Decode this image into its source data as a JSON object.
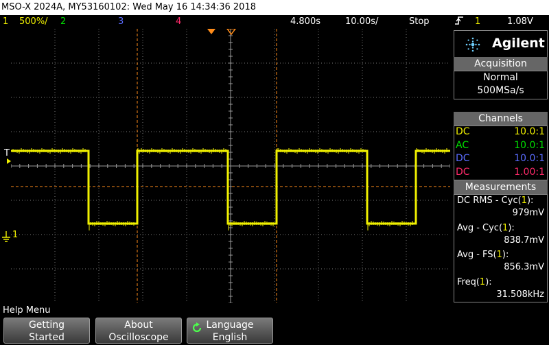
{
  "title": "MSO-X 2024A, MY53160102: Wed May 16 14:34:36 2018",
  "status": {
    "ch1_num": "1",
    "ch1_scale": "500%/",
    "ch2_num": "2",
    "ch3_num": "3",
    "ch4_num": "4",
    "delay": "4.800s",
    "timebase": "10.00s/",
    "run_state": "Stop",
    "trigger_icon": "trigger-edge-icon",
    "trigger_source": "1",
    "trigger_level": "1.08V"
  },
  "screen": {
    "ground_marker": "1",
    "trigger_marker": "T"
  },
  "panel": {
    "brand": "Agilent",
    "acquisition": {
      "header": "Acquisition",
      "mode": "Normal",
      "rate": "500MSa/s"
    },
    "channels": {
      "header": "Channels",
      "rows": [
        {
          "coupling": "DC",
          "probe": "10.0:1",
          "color": "#f0f000"
        },
        {
          "coupling": "AC",
          "probe": "10.0:1",
          "color": "#00e000"
        },
        {
          "coupling": "DC",
          "probe": "10.0:1",
          "color": "#5a6cff"
        },
        {
          "coupling": "DC",
          "probe": "1.00:1",
          "color": "#ff2a6a"
        }
      ]
    },
    "measurements": {
      "header": "Measurements",
      "items": [
        {
          "prefix": "DC RMS - Cyc(",
          "ch": "1",
          "suffix": "):",
          "value": "979mV"
        },
        {
          "prefix": "Avg - Cyc(",
          "ch": "1",
          "suffix": "):",
          "value": "838.7mV"
        },
        {
          "prefix": "Avg - FS(",
          "ch": "1",
          "suffix": "):",
          "value": "856.3mV"
        },
        {
          "prefix": "Freq(",
          "ch": "1",
          "suffix": "):",
          "value": "31.508kHz"
        }
      ]
    }
  },
  "help": "Help Menu",
  "softkeys": [
    {
      "line1": "Getting",
      "line2": "Started"
    },
    {
      "line1": "About",
      "line2": "Oscilloscope"
    },
    {
      "line1": "Language",
      "line2": "English"
    }
  ],
  "colors": {
    "ch1": "#f0f000",
    "ch2": "#00e000",
    "ch3": "#5a6cff",
    "ch4": "#ff2a6a",
    "cursor": "#ff8c1a"
  }
}
